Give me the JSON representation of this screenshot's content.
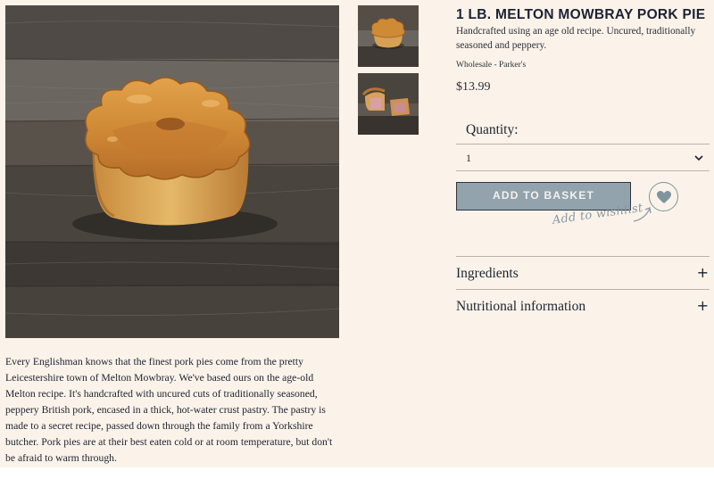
{
  "product": {
    "title": "1 LB. MELTON MOWBRAY PORK PIE",
    "short_description": "Handcrafted using an age old recipe. Uncured, traditionally seasoned and peppery.",
    "vendor": "Wholesale - Parker's",
    "price": "$13.99",
    "long_description": "Every Englishman knows that the finest pork pies come from the pretty Leicestershire town of Melton Mowbray. We've based ours on the age-old Melton recipe. It's handcrafted with uncured cuts of traditionally seasoned, peppery British pork, encased in a thick, hot-water crust pastry. The pastry is made to a secret recipe, passed down through the family from a Yorkshire butcher. Pork pies are at their best eaten cold or at room temperature, but don't be afraid to warm through."
  },
  "quantity": {
    "label": "Quantity:",
    "selected": "1"
  },
  "actions": {
    "add_to_basket": "ADD TO BASKET",
    "wishlist_hint": "Add to wishlist"
  },
  "accordion": [
    {
      "label": "Ingredients",
      "icon": "+"
    },
    {
      "label": "Nutritional information",
      "icon": "+"
    }
  ],
  "colors": {
    "background": "#fbf3ea",
    "button": "#92a3ad",
    "text": "#1c2330",
    "accent": "#7f949d"
  },
  "icons": [
    "chevron-down-icon",
    "heart-icon",
    "arrow-icon",
    "plus-icon"
  ]
}
